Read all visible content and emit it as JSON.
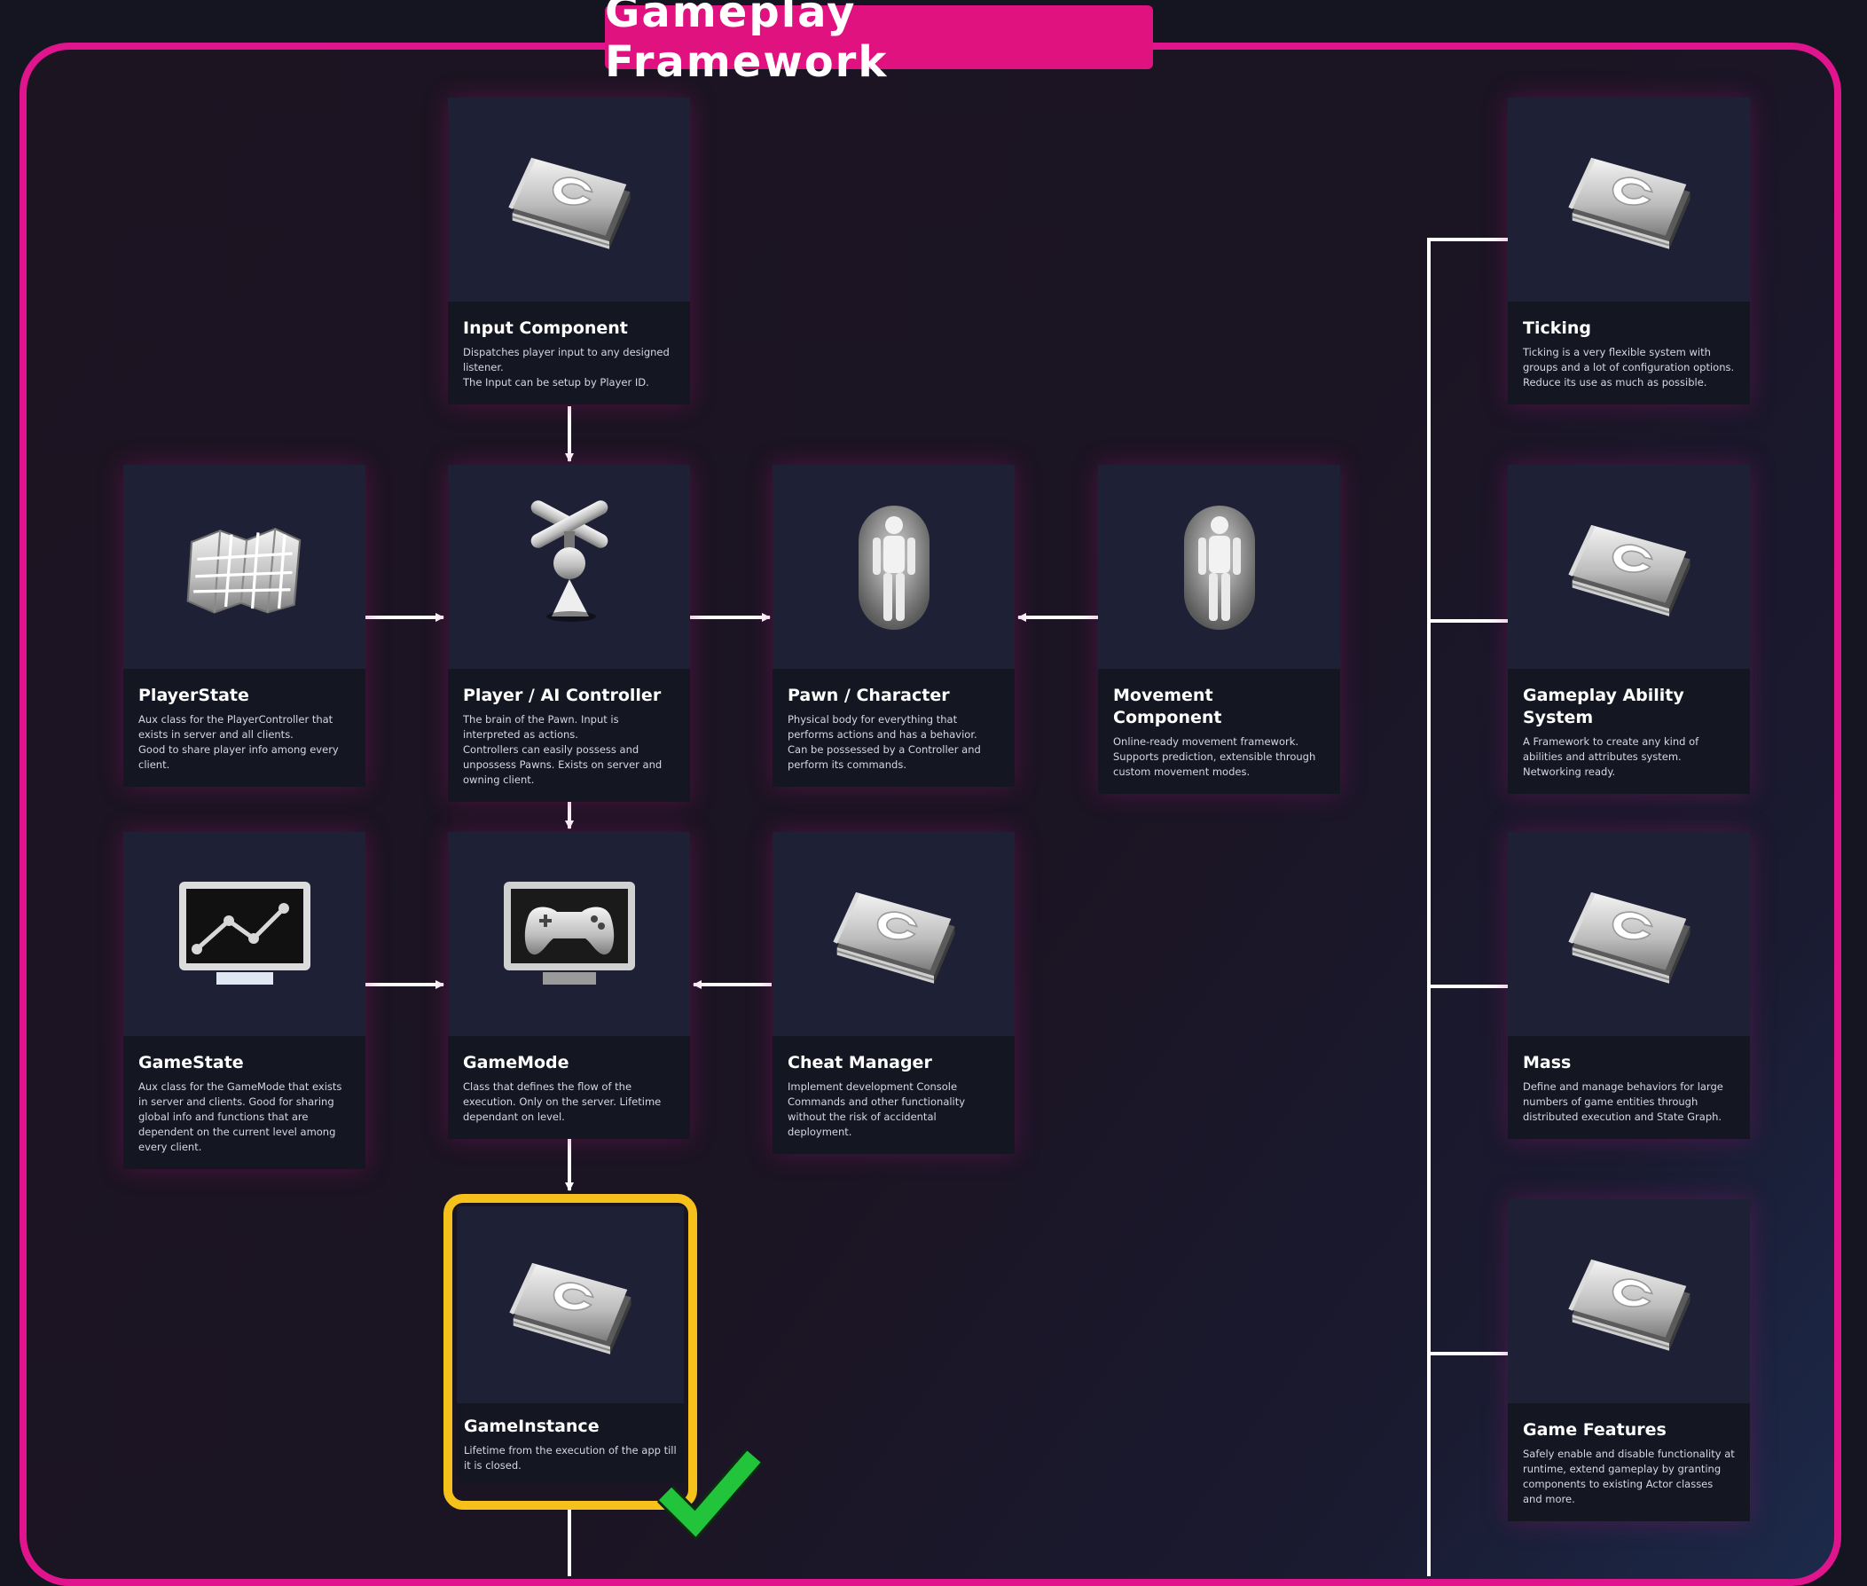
{
  "title": "Gameplay Framework",
  "cards": {
    "input_component": {
      "name": "Input Component",
      "desc": "Dispatches player input to any designed listener.\nThe Input can be setup by Player ID.",
      "icon": "cpp-book-icon"
    },
    "player_state": {
      "name": "PlayerState",
      "desc": "Aux class for the PlayerController that exists in server and all clients.\nGood to share player info among every client.",
      "icon": "map-icon"
    },
    "controller": {
      "name": "Player / AI Controller",
      "desc": "The brain of the Pawn. Input is interpreted as actions.\nControllers can easily possess and unpossess Pawns. Exists on server and owning client.",
      "icon": "controller-icon"
    },
    "pawn": {
      "name": "Pawn / Character",
      "desc": "Physical body for everything that performs actions and has a behavior. Can be possessed by a Controller and perform its commands.",
      "icon": "character-icon"
    },
    "movement": {
      "name": "Movement Component",
      "desc": "Online-ready movement framework.\nSupports prediction, extensible through custom movement modes.",
      "icon": "character-icon"
    },
    "game_state": {
      "name": "GameState",
      "desc": "Aux class for the GameMode that exists in server and clients. Good for sharing global info and functions that are dependent on the current level among every client.",
      "icon": "monitor-graph-icon"
    },
    "game_mode": {
      "name": "GameMode",
      "desc": "Class that defines the flow of the execution. Only on the server. Lifetime dependant on level.",
      "icon": "gamepad-monitor-icon"
    },
    "cheat_manager": {
      "name": "Cheat Manager",
      "desc": "Implement development Console Commands and other functionality without the risk of accidental deployment.",
      "icon": "cpp-book-icon"
    },
    "game_instance": {
      "name": "GameInstance",
      "desc": "Lifetime from the execution of the app till it is closed.",
      "icon": "cpp-book-icon"
    },
    "ticking": {
      "name": "Ticking",
      "desc": "Ticking is a very flexible system with groups and a lot of configuration options. Reduce its use as much as possible.",
      "icon": "cpp-book-icon"
    },
    "gas": {
      "name": "Gameplay Ability System",
      "desc": "A Framework to create any kind of abilities and attributes system.\nNetworking ready.",
      "icon": "cpp-book-icon"
    },
    "mass": {
      "name": "Mass",
      "desc": "Define and manage behaviors for large numbers of game entities through distributed execution and State Graph.",
      "icon": "cpp-book-icon"
    },
    "game_features": {
      "name": "Game Features",
      "desc": "Safely enable and disable functionality at runtime, extend gameplay by granting components to existing Actor classes and more.",
      "icon": "cpp-book-icon"
    }
  },
  "colors": {
    "accent": "#e0158d",
    "highlight": "#f6c11b",
    "check": "#22c43c",
    "card_img": "#1e2036",
    "card_body": "#141622"
  }
}
